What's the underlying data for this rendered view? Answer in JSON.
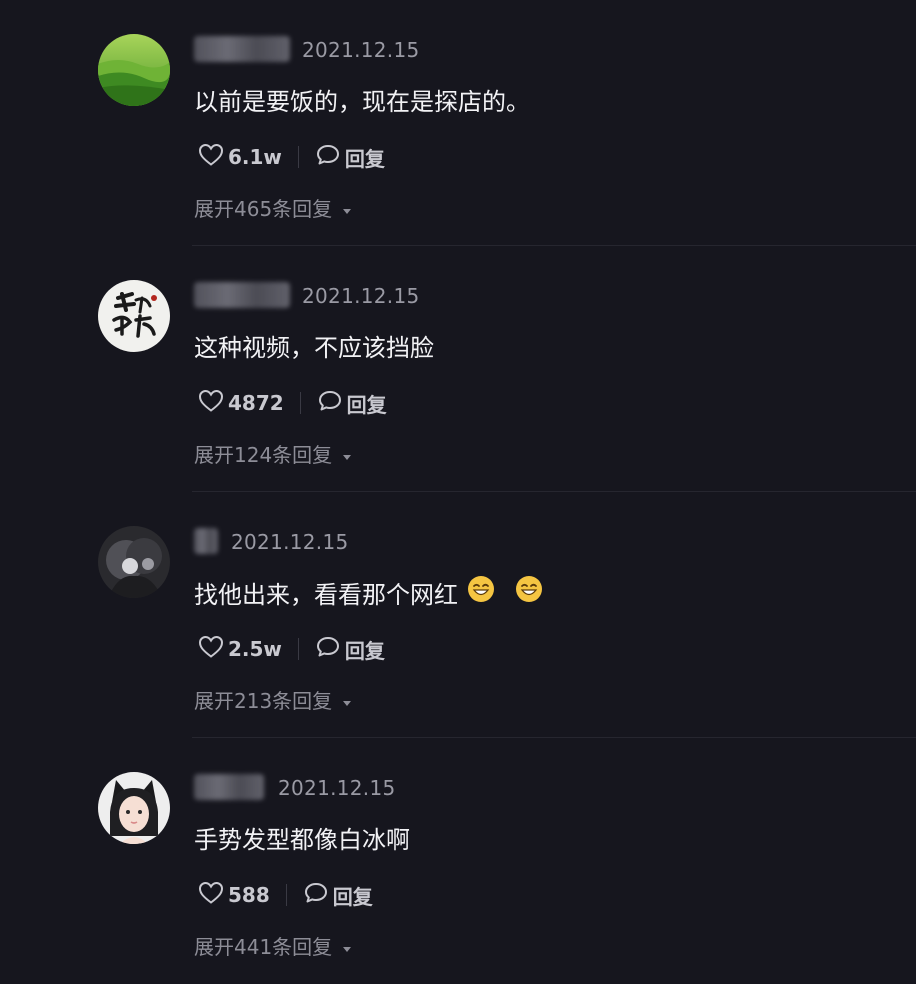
{
  "comments": [
    {
      "date": "2021.12.15",
      "text": "以前是要饭的，现在是探店的。",
      "likes": "6.1w",
      "reply_label": "回复",
      "expand_label": "展开465条回复"
    },
    {
      "date": "2021.12.15",
      "text": "这种视频，不应该挡脸",
      "likes": "4872",
      "reply_label": "回复",
      "expand_label": "展开124条回复"
    },
    {
      "date": "2021.12.15",
      "text": "找他出来，看看那个网红",
      "likes": "2.5w",
      "reply_label": "回复",
      "expand_label": "展开213条回复",
      "emojis": [
        "grin-emoji",
        "grin-emoji"
      ]
    },
    {
      "date": "2021.12.15",
      "text": "手势发型都像白冰啊",
      "likes": "588",
      "reply_label": "回复",
      "expand_label": "展开441条回复"
    }
  ],
  "icons": {
    "like": "heart-outline-icon",
    "reply": "speech-bubble-icon",
    "expand": "caret-down-icon"
  },
  "colors": {
    "background": "#16161e",
    "text": "#f2f2f5",
    "meta": "#9a9aa4",
    "emoji": "#f5c542"
  }
}
